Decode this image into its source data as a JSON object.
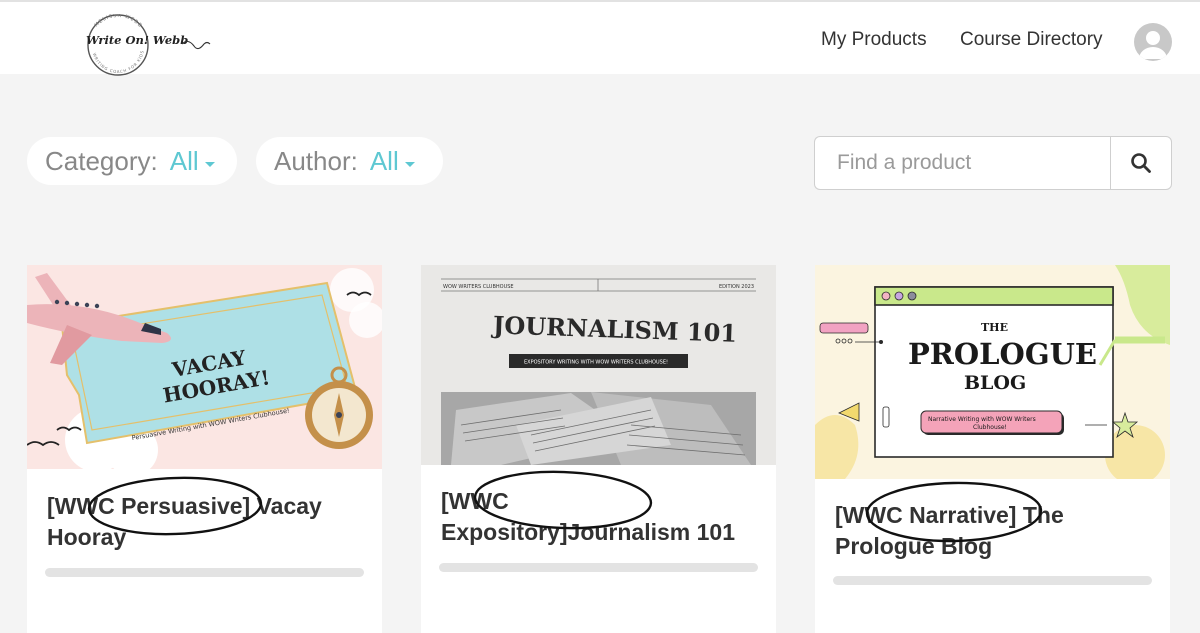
{
  "header": {
    "logo_text": "Write On! Webb",
    "logo_ring_text": "MELISSA WEBB · WRITING COACH FOR KIDS",
    "nav": [
      "My Products",
      "Course Directory"
    ]
  },
  "filters": {
    "category_label": "Category:",
    "category_value": "All",
    "author_label": "Author:",
    "author_value": "All"
  },
  "search": {
    "placeholder": "Find a product"
  },
  "colors": {
    "accent": "#5ec8d2",
    "page_bg": "#f4f4f4",
    "card_bg": "#ffffff"
  },
  "products": [
    {
      "title": "[WWC Persuasive] Vacay Hooray",
      "progress": 0,
      "image": {
        "headline_1": "VACAY",
        "headline_2": "HOORAY!",
        "subtitle": "Persuasive Writing with WOW Writers Clubhouse!"
      }
    },
    {
      "title": "[WWC Expository]Journalism 101",
      "progress": 0,
      "image": {
        "masthead_left": "WOW WRITERS CLUBHOUSE",
        "masthead_right": "EDITION 2023",
        "headline": "JOURNALISM 101",
        "subtitle": "EXPOSITORY WRITING WITH WOW WRITERS CLUBHOUSE!"
      }
    },
    {
      "title": "[WWC Narrative] The Prologue Blog",
      "progress": 0,
      "image": {
        "headline_1": "THE",
        "headline_2": "PROLOGUE",
        "headline_3": "BLOG",
        "subtitle_1": "Narrative Writing with WOW Writers",
        "subtitle_2": "Clubhouse!"
      }
    }
  ]
}
